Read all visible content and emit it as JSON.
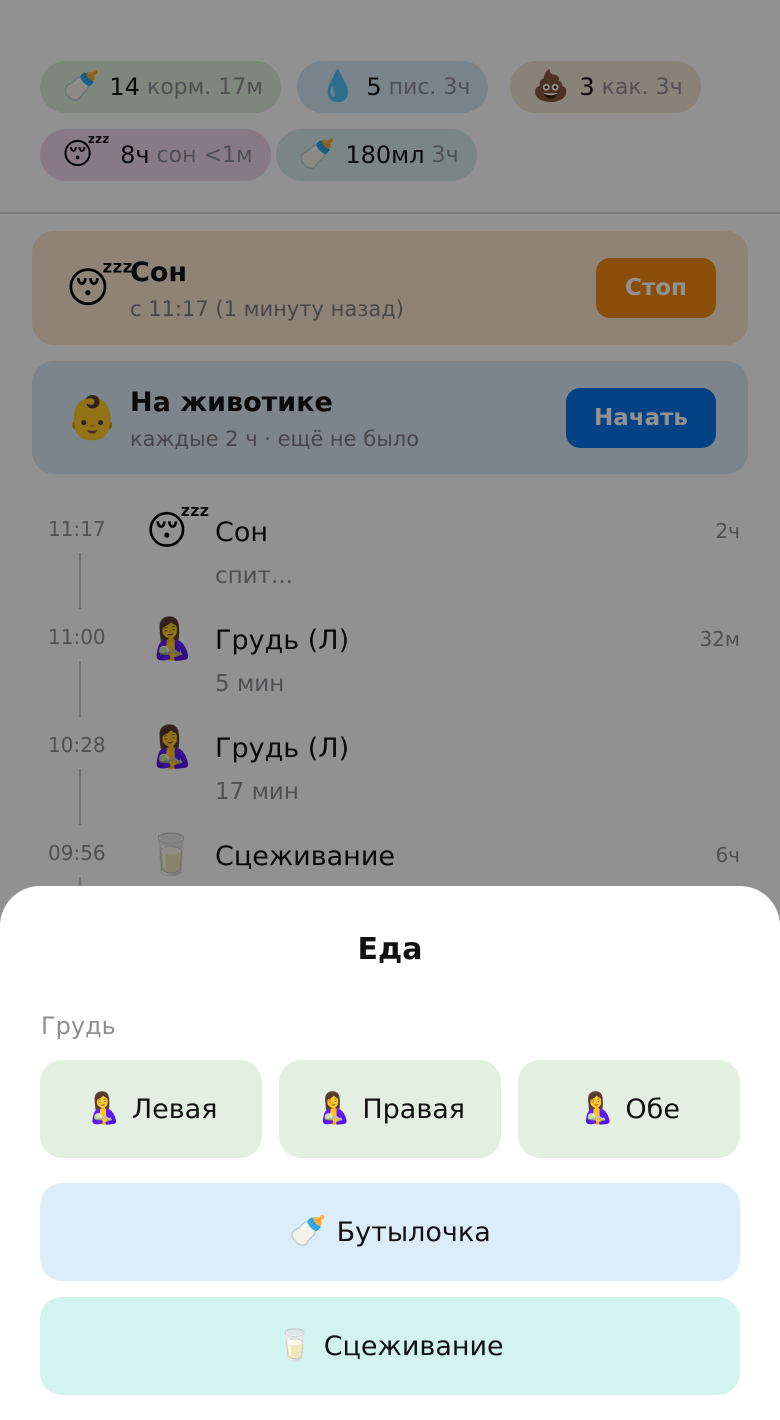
{
  "stats": [
    {
      "icon": "baby-bottle-icon",
      "emoji": "🍼",
      "count": "14",
      "label": "корм. 17м"
    },
    {
      "icon": "droplet-icon",
      "emoji": "💧",
      "count": "5",
      "label": "пис. 3ч"
    },
    {
      "icon": "poop-icon",
      "emoji": "💩",
      "count": "3",
      "label": "как. 3ч"
    },
    {
      "icon": "sleeping-face-icon",
      "emoji": "😴",
      "count": "8ч",
      "label": "сон <1м"
    },
    {
      "icon": "baby-bottle-icon",
      "emoji": "🍼",
      "count": "180мл",
      "label": "3ч"
    }
  ],
  "active": {
    "sleep": {
      "icon": "sleeping-face-icon",
      "emoji": "😴",
      "title": "Сон",
      "subtitle": "с 11:17 (1 минуту назад)",
      "button": "Стоп",
      "button_color": "#f58a12"
    },
    "tummy": {
      "icon": "baby-face-icon",
      "emoji": "👶",
      "title": "На животике",
      "subtitle": "каждые 2 ч · ещё не было",
      "button": "Начать",
      "button_color": "#0a74e6"
    }
  },
  "timeline": [
    {
      "time": "11:17",
      "icon": "sleeping-face-icon",
      "emoji": "😴",
      "title": "Сон",
      "subtitle": "спит...",
      "ago": "2ч"
    },
    {
      "time": "11:00",
      "icon": "breastfeeding-icon",
      "emoji": "🤱",
      "title": "Грудь (Л)",
      "subtitle": "5 мин",
      "ago": "32м"
    },
    {
      "time": "10:28",
      "icon": "breastfeeding-icon",
      "emoji": "🤱",
      "title": "Грудь (Л)",
      "subtitle": "17 мин",
      "ago": ""
    },
    {
      "time": "09:56",
      "icon": "milk-glass-icon",
      "emoji": "🥛",
      "title": "Сцеживание",
      "subtitle": "",
      "ago": "6ч"
    }
  ],
  "sheet": {
    "title": "Еда",
    "section_label": "Грудь",
    "breast_options": [
      {
        "icon": "breastfeeding-icon",
        "emoji": "🤱",
        "label": "Левая"
      },
      {
        "icon": "breastfeeding-icon",
        "emoji": "🤱",
        "label": "Правая"
      },
      {
        "icon": "breastfeeding-icon",
        "emoji": "🤱",
        "label": "Обе"
      }
    ],
    "bottle": {
      "icon": "baby-bottle-icon",
      "emoji": "🍼",
      "label": "Бутылочка"
    },
    "pump": {
      "icon": "milk-glass-icon",
      "emoji": "🥛",
      "label": "Сцеживание"
    }
  },
  "colors": {
    "accent_orange": "#f58a12",
    "accent_blue": "#0a74e6",
    "overlay": "rgba(0,0,0,0.43)"
  }
}
